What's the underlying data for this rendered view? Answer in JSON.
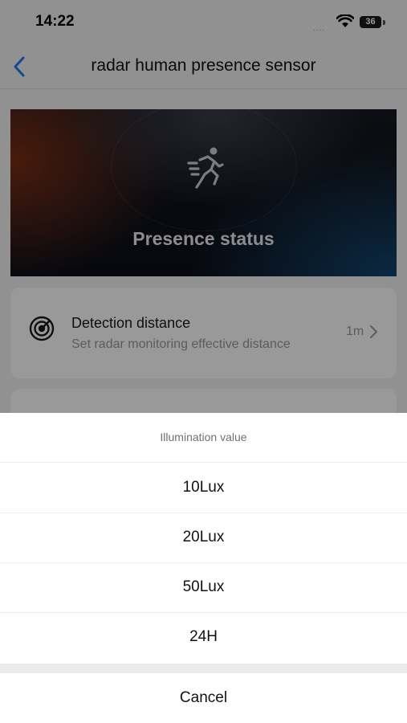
{
  "status_bar": {
    "time": "14:22",
    "signal": "....",
    "battery": "36"
  },
  "nav": {
    "title": "radar human presence sensor"
  },
  "hero": {
    "title": "Presence status"
  },
  "detection_card": {
    "title": "Detection distance",
    "subtitle": "Set radar monitoring effective distance",
    "value": "1m"
  },
  "sheet": {
    "title": "Illumination value",
    "options": [
      "10Lux",
      "20Lux",
      "50Lux",
      "24H"
    ],
    "cancel_label": "Cancel"
  },
  "colors": {
    "accent": "#1a7cf0",
    "overlay": "rgba(0,0,0,0.4)"
  },
  "icons": {
    "back": "chevron-left-icon",
    "hero": "running-person-icon",
    "card": "radar-target-icon",
    "card_chevron": "chevron-right-icon",
    "wifi": "wifi-icon"
  }
}
